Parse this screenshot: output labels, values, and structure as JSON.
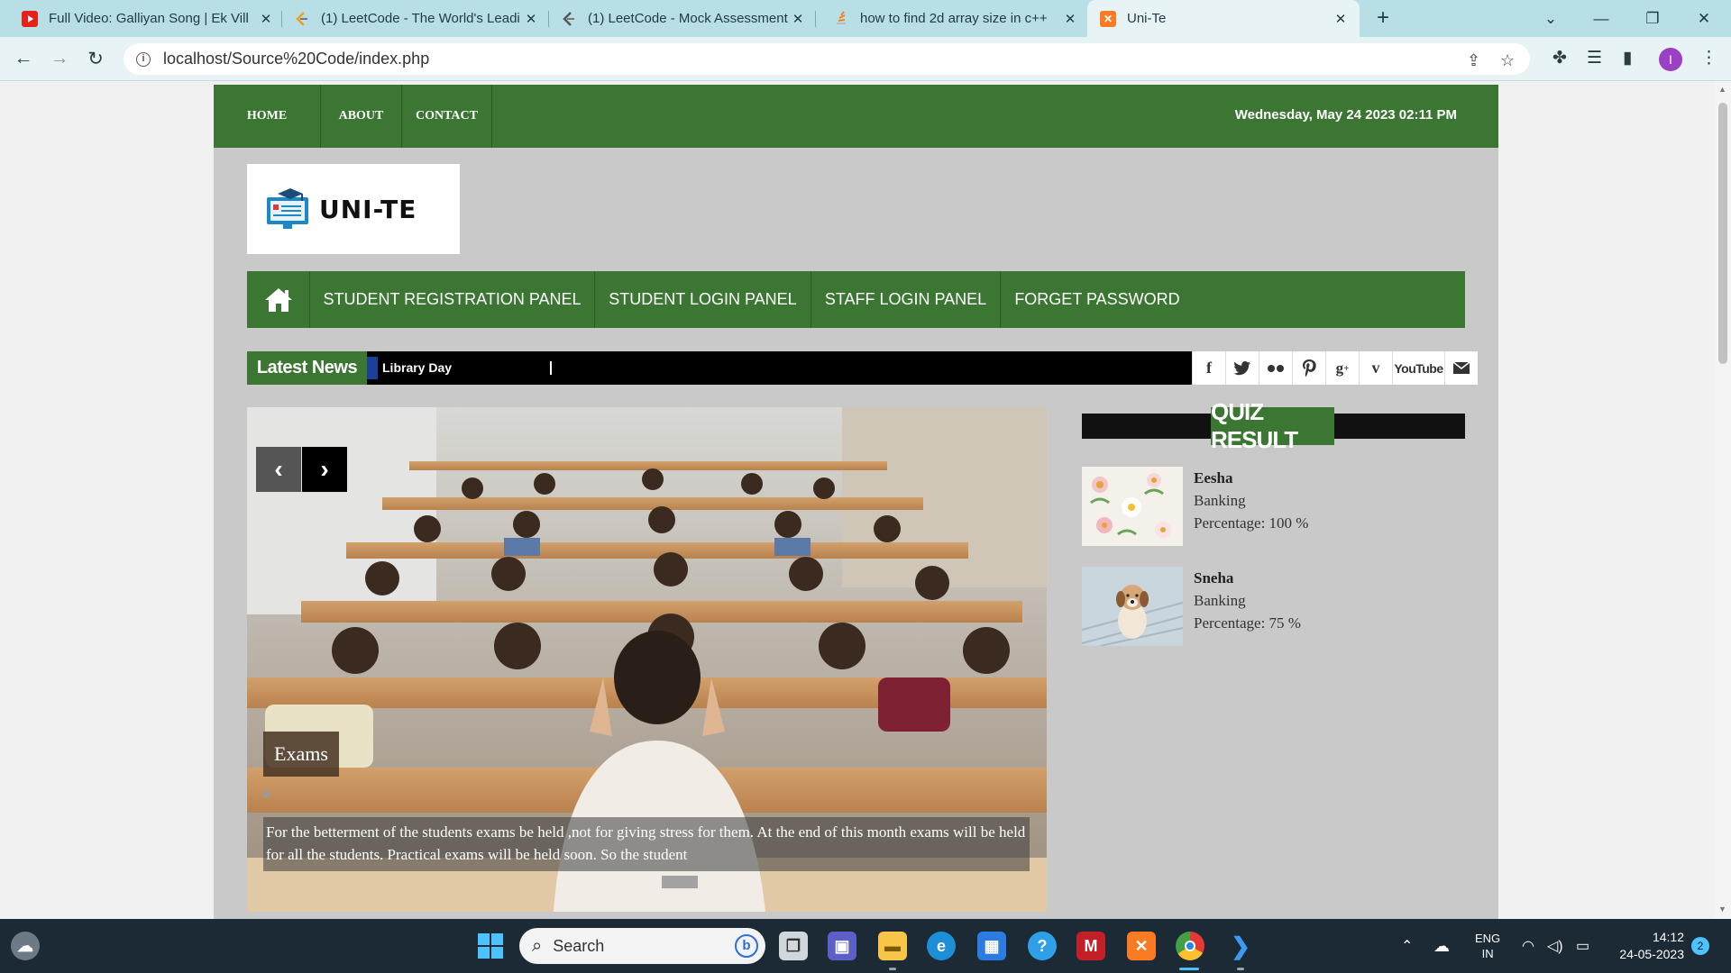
{
  "browser": {
    "tabs": [
      {
        "title": "Full Video: Galliyan Song | Ek Vill",
        "icon": "youtube-icon",
        "active": false
      },
      {
        "title": "(1) LeetCode - The World's Leadi",
        "icon": "leetcode-icon",
        "active": false
      },
      {
        "title": "(1) LeetCode - Mock Assessment",
        "icon": "leetcode-icon",
        "active": false
      },
      {
        "title": "how to find 2d array size in c++",
        "icon": "stackoverflow-icon",
        "active": false
      },
      {
        "title": "Uni-Te",
        "icon": "xampp-icon",
        "active": true
      }
    ],
    "url": "localhost/Source%20Code/index.php",
    "profile_initial": "I"
  },
  "site": {
    "top_nav": [
      "HOME",
      "ABOUT",
      "CONTACT"
    ],
    "datetime": "Wednesday, May 24 2023 02:11 PM",
    "logo_text": "UNI-TE",
    "main_menu": [
      "STUDENT REGISTRATION PANEL",
      "STUDENT LOGIN PANEL",
      "STAFF LOGIN PANEL",
      "FORGET PASSWORD"
    ],
    "news": {
      "label": "Latest News",
      "headline": "Library Day"
    },
    "social": [
      "facebook-icon",
      "twitter-icon",
      "flickr-icon",
      "pinterest-icon",
      "googleplus-icon",
      "vimeo-icon",
      "youtube-icon",
      "email-icon"
    ],
    "social_text": {
      "youtube": "YouTube"
    },
    "slider": {
      "caption_title": "Exams",
      "caption_text": "For the betterment of the students exams be held ,not for giving stress for them. At the end of this month exams will be held for all the students. Practical exams will be held soon. So the student"
    },
    "quiz": {
      "title": "QUIZ RESULT",
      "entries": [
        {
          "name": "Eesha",
          "subject": "Banking",
          "percentage": "Percentage: 100 %"
        },
        {
          "name": "Sneha",
          "subject": "Banking",
          "percentage": "Percentage: 75 %"
        }
      ]
    }
  },
  "taskbar": {
    "search_label": "Search",
    "lang_top": "ENG",
    "lang_bottom": "IN",
    "time": "14:12",
    "date": "24-05-2023",
    "notifications": "2"
  },
  "colors": {
    "site_green": "#3b7633",
    "tab_bar": "#b9dfe6",
    "taskbar": "#1c2a36"
  }
}
